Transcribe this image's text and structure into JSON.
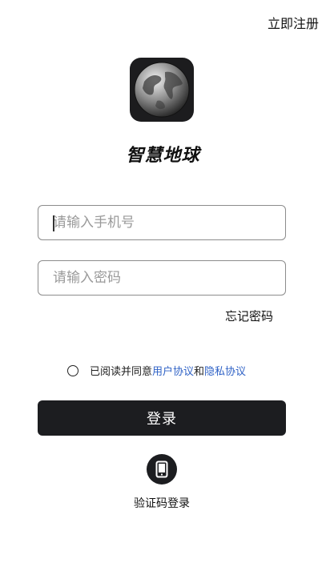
{
  "header": {
    "register_label": "立即注册"
  },
  "app": {
    "name": "智慧地球",
    "logo_icon": "globe-icon"
  },
  "form": {
    "phone_placeholder": "请输入手机号",
    "phone_value": "",
    "password_placeholder": "请输入密码",
    "password_value": "",
    "forgot_label": "忘记密码"
  },
  "agreement": {
    "checked": false,
    "prefix": "已阅读并同意",
    "user_agreement": "用户协议",
    "conjunction": "和",
    "privacy_policy": "隐私协议"
  },
  "actions": {
    "login_label": "登录",
    "sms_login_label": "验证码登录",
    "sms_icon": "phone-icon"
  },
  "colors": {
    "primary_dark": "#1c1d20",
    "link_blue": "#2f62c6",
    "border": "#8c8c8c"
  }
}
